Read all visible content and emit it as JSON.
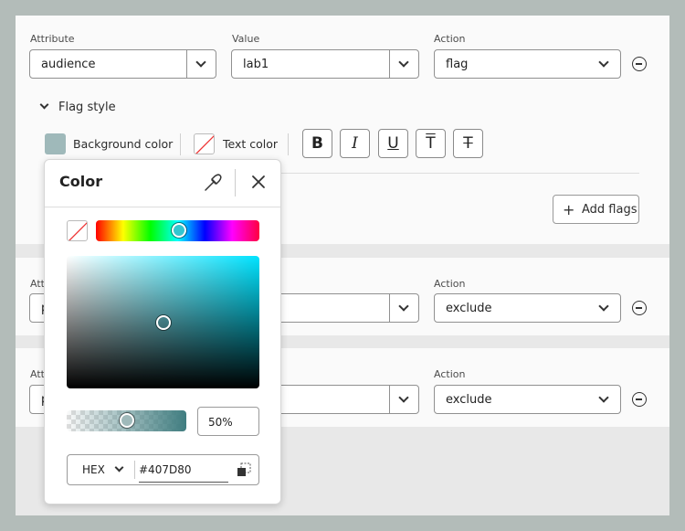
{
  "rule1": {
    "attribute_label": "Attribute",
    "attribute_value": "audience",
    "value_label": "Value",
    "value_value": "lab1",
    "action_label": "Action",
    "action_value": "flag"
  },
  "flag_style": {
    "label": "Flag style",
    "background_label": "Background color",
    "text_label": "Text color",
    "background_color": "#9fb9ba",
    "format_buttons": [
      "B",
      "I",
      "U",
      "T",
      "T"
    ],
    "add_flags_label": "Add flags"
  },
  "rule2": {
    "attribute_label": "Attri",
    "attribute_value": "p",
    "action_label": "Action",
    "action_value": "exclude"
  },
  "rule3": {
    "attribute_label": "Attri",
    "attribute_value": "p",
    "action_label": "Action",
    "action_value": "exclude"
  },
  "color_popover": {
    "title": "Color",
    "hue_position": 0.51,
    "saturation": 0.5,
    "brightness": 0.5,
    "opacity_label": "50%",
    "opacity": 0.5,
    "format": "HEX",
    "hex_value": "#407D80"
  }
}
